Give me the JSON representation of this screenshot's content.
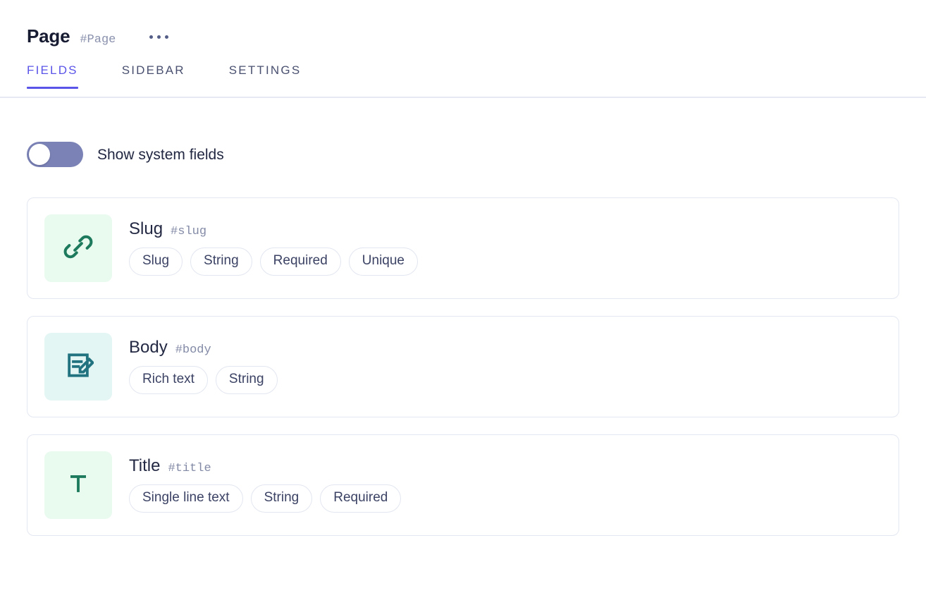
{
  "header": {
    "title": "Page",
    "hash": "#Page",
    "more_icon": "ellipsis-horizontal-icon"
  },
  "tabs": [
    {
      "label": "FIELDS",
      "active": true
    },
    {
      "label": "SIDEBAR",
      "active": false
    },
    {
      "label": "SETTINGS",
      "active": false
    }
  ],
  "toggle": {
    "label": "Show system fields",
    "state": "off",
    "track_color": "#7b82b5",
    "knob_color": "#ffffff"
  },
  "colors": {
    "accent": "#5b54e8",
    "title": "#181c32",
    "hash_text": "#8a91ad",
    "card_border": "#e3e7f1",
    "tag_border": "#e2e6f0",
    "tab_inactive": "#4a5170"
  },
  "fields": [
    {
      "name": "Slug",
      "hash": "#slug",
      "icon": "link-chain-icon",
      "icon_color": "#1d7a5c",
      "icon_bg": "#e9faef",
      "tags": [
        "Slug",
        "String",
        "Required",
        "Unique"
      ]
    },
    {
      "name": "Body",
      "hash": "#body",
      "icon": "document-edit-icon",
      "icon_color": "#227380",
      "icon_bg": "#e3f6f4",
      "tags": [
        "Rich text",
        "String"
      ]
    },
    {
      "name": "Title",
      "hash": "#title",
      "icon": "letter-t-icon",
      "icon_color": "#1d7a5c",
      "icon_bg": "#e9faef",
      "tags": [
        "Single line text",
        "String",
        "Required"
      ]
    }
  ]
}
